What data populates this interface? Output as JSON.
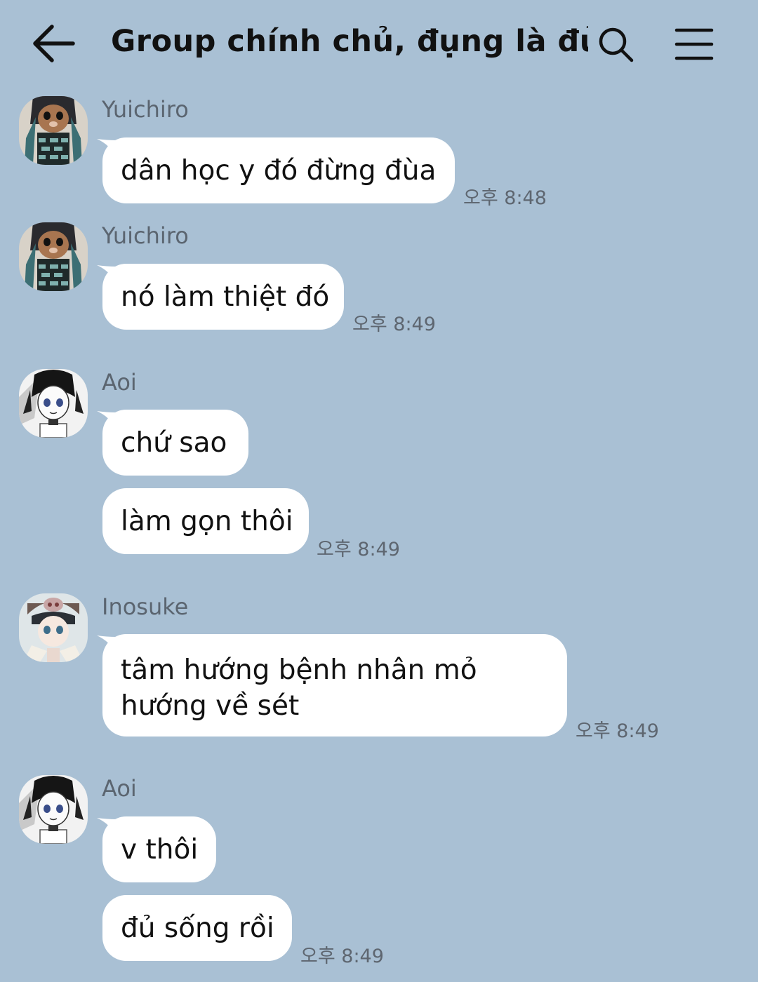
{
  "header": {
    "title": "Group chính chủ, đụng là đủ ...",
    "back_icon": "arrow-left-icon",
    "search_icon": "search-icon",
    "menu_icon": "hamburger-menu-icon"
  },
  "colors": {
    "background": "#a9c0d4",
    "bubble": "#ffffff",
    "sender_text": "#5b6570",
    "timestamp_text": "#5e6670"
  },
  "messages": [
    {
      "sender": "Yuichiro",
      "avatar": "yuichiro-avatar",
      "texts": [
        "dân học y đó đừng đùa"
      ],
      "time": "오후 8:48"
    },
    {
      "sender": "Yuichiro",
      "avatar": "yuichiro-avatar",
      "texts": [
        "nó làm thiệt đó"
      ],
      "time": "오후 8:49"
    },
    {
      "sender": "Aoi",
      "avatar": "aoi-avatar",
      "texts": [
        "chứ sao",
        "làm gọn thôi"
      ],
      "time": "오후 8:49"
    },
    {
      "sender": "Inosuke",
      "avatar": "inosuke-avatar",
      "texts": [
        "tâm hướng bệnh nhân mỏ hướng về sét"
      ],
      "time": "오후 8:49"
    },
    {
      "sender": "Aoi",
      "avatar": "aoi-avatar",
      "texts": [
        "v thôi",
        "đủ sống rồi"
      ],
      "time": "오후 8:49"
    }
  ]
}
